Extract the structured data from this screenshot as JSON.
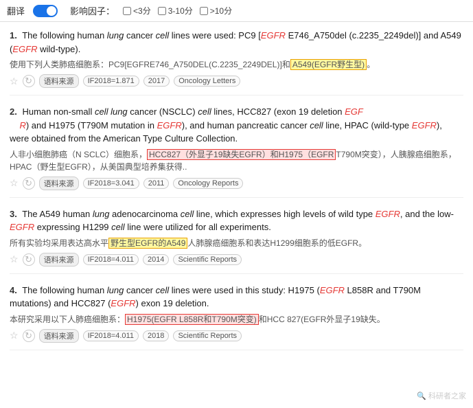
{
  "topbar": {
    "translate_label": "翻译",
    "filter_label": "影响因子：",
    "filters": [
      {
        "id": "f1",
        "label": "<3分",
        "checked": false
      },
      {
        "id": "f2",
        "label": "3-10分",
        "checked": false
      },
      {
        "id": "f3",
        "label": ">10分",
        "checked": false
      }
    ]
  },
  "results": [
    {
      "number": "1.",
      "english_parts": [
        {
          "text": "The following human ",
          "type": "normal"
        },
        {
          "text": "lung",
          "type": "italic"
        },
        {
          "text": " cancer ",
          "type": "normal"
        },
        {
          "text": "cell",
          "type": "italic"
        },
        {
          "text": " lines were used: PC9 [",
          "type": "normal"
        },
        {
          "text": "EGFR",
          "type": "red-italic"
        },
        {
          "text": " E746_A750del (c.2235_2249del)] and A549 (",
          "type": "normal"
        },
        {
          "text": "EGFR",
          "type": "red-italic"
        },
        {
          "text": " wild-type).",
          "type": "normal"
        }
      ],
      "chinese": "使用下列人类肺癌细胞系：PC9[EGFRE746_A750DEL(C.2235_2249DEL)]和",
      "chinese_highlight": "A549(EGFR野生型)。",
      "source": "语料来源",
      "if": "IF2018=1.871",
      "year": "2017",
      "journal": "Oncology Letters"
    },
    {
      "number": "2.",
      "english_parts": [
        {
          "text": "Human non-small ",
          "type": "normal"
        },
        {
          "text": "cell lung",
          "type": "italic"
        },
        {
          "text": " cancer (NSCLC) ",
          "type": "normal"
        },
        {
          "text": "cell",
          "type": "italic"
        },
        {
          "text": " lines, HCC827 (exon 19 deletion ",
          "type": "normal"
        },
        {
          "text": "EGF R",
          "type": "red-italic"
        },
        {
          "text": ") and H1975 (T790M mutation in ",
          "type": "normal"
        },
        {
          "text": "EGFR",
          "type": "red-italic"
        },
        {
          "text": "), and human pancreatic cancer ",
          "type": "normal"
        },
        {
          "text": "cell",
          "type": "italic"
        },
        {
          "text": " line, HPAC (wild-type ",
          "type": "normal"
        },
        {
          "text": "EGFR",
          "type": "red-italic"
        },
        {
          "text": "), were obtained from the American Type Culture Collection.",
          "type": "normal"
        }
      ],
      "chinese": "人非小细胞肺癌（N SCLC）细胞系，",
      "chinese_highlight_1": "HCC827（外显子19缺失EGFR）和H1975（EGFR",
      "chinese_middle": "T790M突变），人胰腺癌细胞系，HPAC（野生型EGFR），从美国典型培养集获得..",
      "source": "语料来源",
      "if": "IF2018=3.041",
      "year": "2011",
      "journal": "Oncology Reports"
    },
    {
      "number": "3.",
      "english_parts": [
        {
          "text": "The A549 human ",
          "type": "normal"
        },
        {
          "text": "lung",
          "type": "italic"
        },
        {
          "text": " adenocarcinoma ",
          "type": "normal"
        },
        {
          "text": "cell",
          "type": "italic"
        },
        {
          "text": " line, which expresses high levels of wild type ",
          "type": "normal"
        },
        {
          "text": "EGFR",
          "type": "red-italic"
        },
        {
          "text": ", and the low-",
          "type": "normal"
        },
        {
          "text": "EGFR",
          "type": "red-italic"
        },
        {
          "text": " expressing H1299 ",
          "type": "normal"
        },
        {
          "text": "cell",
          "type": "italic"
        },
        {
          "text": " line were utilized for all experiments.",
          "type": "normal"
        }
      ],
      "chinese": "所有实验均采用表达高水平",
      "chinese_highlight": "野生型EGFR的A549",
      "chinese_end": "人肺腺癌细胞系和表达H1299细胞系的低EGFR。",
      "source": "语料来源",
      "if": "IF2018=4.011",
      "year": "2014",
      "journal": "Scientific Reports"
    },
    {
      "number": "4.",
      "english_parts": [
        {
          "text": "The following human ",
          "type": "normal"
        },
        {
          "text": "lung",
          "type": "italic"
        },
        {
          "text": " cancer ",
          "type": "normal"
        },
        {
          "text": "cell",
          "type": "italic"
        },
        {
          "text": " lines were used in this study: H1975 (",
          "type": "normal"
        },
        {
          "text": "EGFR",
          "type": "red-italic"
        },
        {
          "text": " L858R and T790M mutations) and HCC827 (",
          "type": "normal"
        },
        {
          "text": "EGFR",
          "type": "red-italic"
        },
        {
          "text": " exon 19 deletion.",
          "type": "normal"
        }
      ],
      "chinese": "本研究采用以下人肺癌细胞系：",
      "chinese_highlight": "H1975(EGFR L858R和T790M突变)",
      "chinese_end": "和HCC 827(EGFR外显子19缺失。",
      "source": "语料来源",
      "if": "IF2018=4.011",
      "year": "2018",
      "journal": "Scientific Reports"
    }
  ],
  "watermark": "科研者之家"
}
